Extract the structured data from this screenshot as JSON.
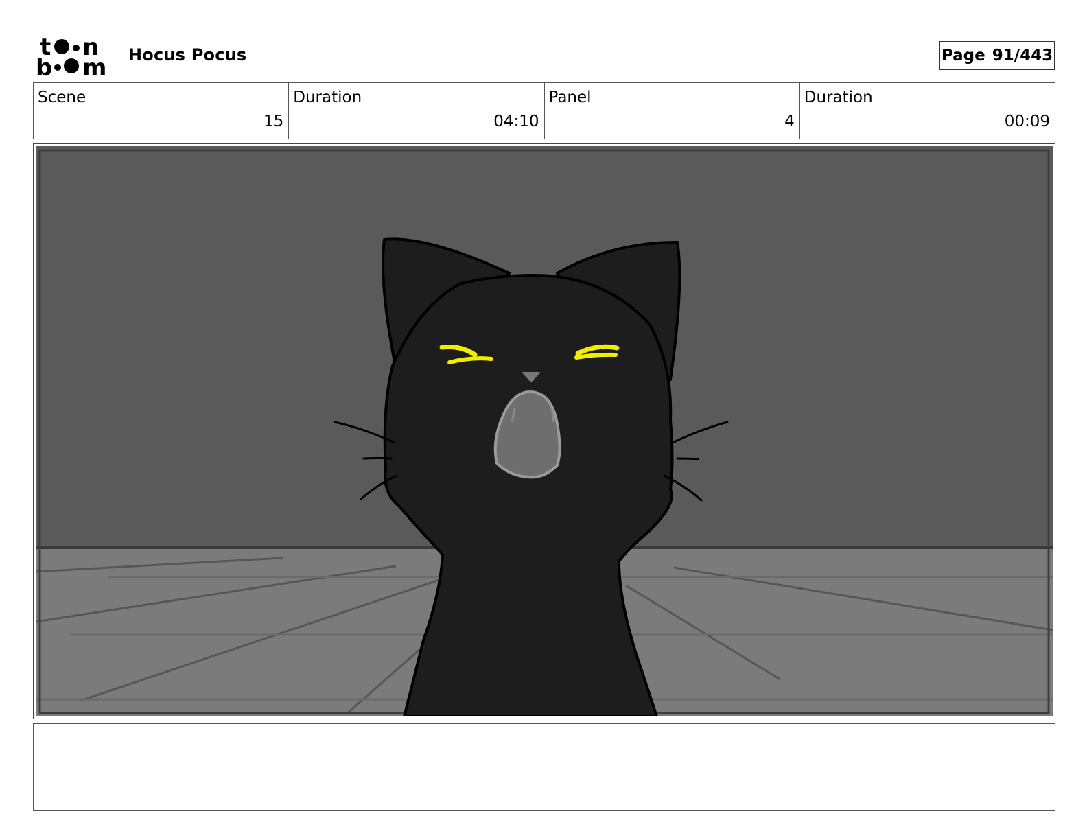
{
  "header": {
    "logo_text": "toon boom",
    "project_title": "Hocus Pocus",
    "page_label": "Page",
    "page_number": "91/443"
  },
  "info": {
    "scene_label": "Scene",
    "scene_value": "15",
    "scene_duration_label": "Duration",
    "scene_duration_value": "04:10",
    "panel_label": "Panel",
    "panel_value": "4",
    "panel_duration_label": "Duration",
    "panel_duration_value": "00:09"
  },
  "panel": {
    "colors": {
      "wall": "#5a5a5a",
      "floor": "#7b7b7b",
      "cat_body": "#1d1d1d",
      "eyes": "#f2ee00",
      "mouth": "#6e6e6e"
    }
  },
  "notes": {
    "text": ""
  }
}
